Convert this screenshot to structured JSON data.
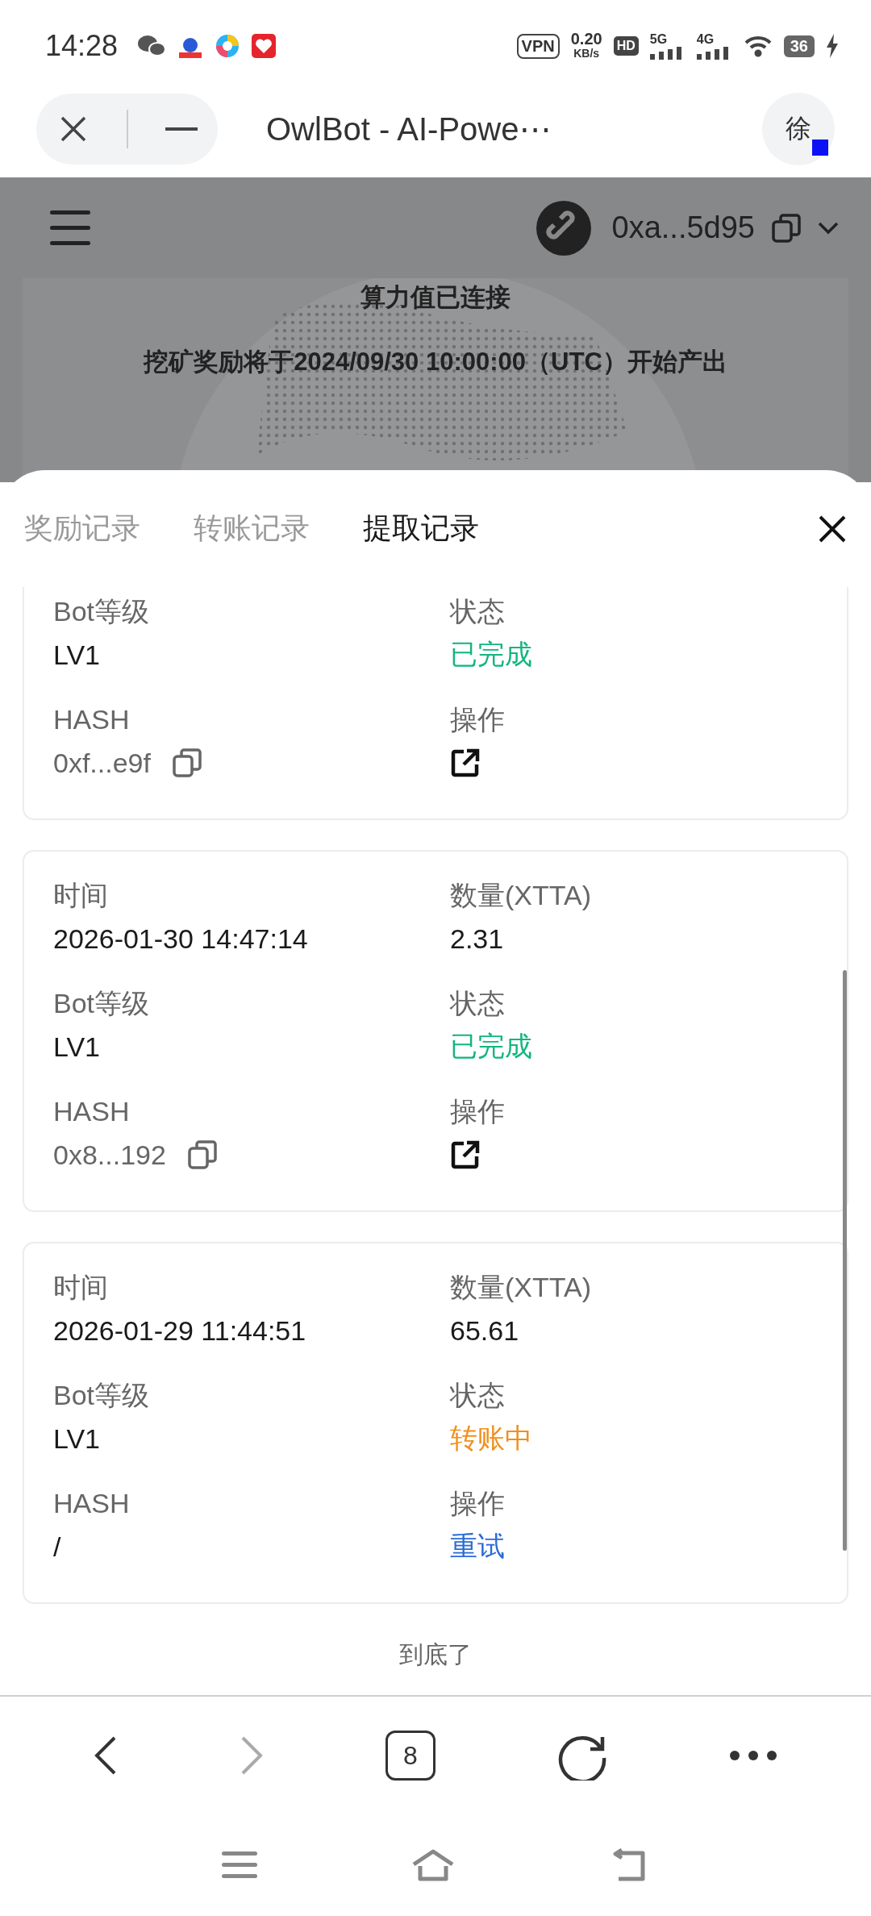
{
  "status_bar": {
    "time": "14:28",
    "vpn": "VPN",
    "speed": "0.20",
    "speed_unit": "KB/s",
    "hd": "HD",
    "net_1": "5G",
    "net_2": "4G",
    "battery": "36"
  },
  "browser": {
    "title": "OwlBot - AI-Powe⋯",
    "avatar": "徐"
  },
  "app_header": {
    "address": "0xa...5d95"
  },
  "hero": {
    "line_1": "算力值已连接",
    "line_2": "挖矿奖励将于2024/09/30 10:00:00（UTC）开始产出"
  },
  "tabs": [
    {
      "label": "奖励记录",
      "selected": false
    },
    {
      "label": "转账记录",
      "selected": false
    },
    {
      "label": "提取记录",
      "selected": true
    }
  ],
  "records": [
    {
      "cells": [
        {
          "label": "Bot等级",
          "value": "LV1",
          "kind": "text"
        },
        {
          "label": "状态",
          "value": "已完成",
          "kind": "status",
          "color": "#13b57e"
        },
        {
          "label": "HASH",
          "value": "0xf...e9f",
          "kind": "hash"
        },
        {
          "label": "操作",
          "kind": "open"
        }
      ]
    },
    {
      "cells": [
        {
          "label": "时间",
          "value": "2026-01-30 14:47:14",
          "kind": "text"
        },
        {
          "label": "数量(XTTA)",
          "value": "2.31",
          "kind": "text"
        },
        {
          "label": "Bot等级",
          "value": "LV1",
          "kind": "text"
        },
        {
          "label": "状态",
          "value": "已完成",
          "kind": "status",
          "color": "#13b57e"
        },
        {
          "label": "HASH",
          "value": "0x8...192",
          "kind": "hash"
        },
        {
          "label": "操作",
          "kind": "open"
        }
      ]
    },
    {
      "cells": [
        {
          "label": "时间",
          "value": "2026-01-29 11:44:51",
          "kind": "text"
        },
        {
          "label": "数量(XTTA)",
          "value": "65.61",
          "kind": "text"
        },
        {
          "label": "Bot等级",
          "value": "LV1",
          "kind": "text"
        },
        {
          "label": "状态",
          "value": "转账中",
          "kind": "status",
          "color": "#f0901c"
        },
        {
          "label": "HASH",
          "value": "/",
          "kind": "text"
        },
        {
          "label": "操作",
          "value": "重试",
          "kind": "retry"
        }
      ]
    }
  ],
  "end_note": "到底了",
  "nav": {
    "tab_count": "8"
  }
}
